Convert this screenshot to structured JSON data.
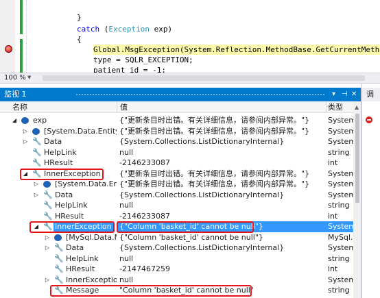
{
  "editor": {
    "lines": [
      {
        "text": "}"
      },
      {
        "kw": "catch",
        "open": " (",
        "ty": "Exception",
        "rest": " exp)"
      },
      {
        "text": "{"
      },
      {
        "text": "Global.MsgException(System.Reflection.MethodBase.GetCurrentMethod().Nam"
      },
      {
        "text": "type = SQLR_EXCEPTION;"
      },
      {
        "text": "patient_id = -1;"
      }
    ]
  },
  "zoom": {
    "level": "100 %"
  },
  "watch": {
    "title": "监视 1",
    "buttons": {
      "dropdown": "▾",
      "pin": "⊣",
      "close": "✕"
    },
    "columns": {
      "name": "名称",
      "value": "值",
      "type": "类型"
    },
    "rows": [
      {
        "name": "exp",
        "value": "{\"更新条目时出错。有关详细信息，请参阅内部异常。\"}",
        "type": "System.E"
      },
      {
        "name": "[System.Data.Entity.In",
        "value": "{\"更新条目时出错。有关详细信息，请参阅内部异常。\"}",
        "type": "System.D"
      },
      {
        "name": "Data",
        "value": "{System.Collections.ListDictionaryInternal}",
        "type": "System.C"
      },
      {
        "name": "HelpLink",
        "value": "null",
        "type": "string"
      },
      {
        "name": "HResult",
        "value": "-2146233087",
        "type": "int"
      },
      {
        "name": "InnerException",
        "value": "{\"更新条目时出错。有关详细信息，请参阅内部异常。\"}",
        "type": "System.E"
      },
      {
        "name": "[System.Data.Entit",
        "value": "{\"更新条目时出错。有关详细信息，请参阅内部异常。\"}",
        "type": "System.D"
      },
      {
        "name": "Data",
        "value": "{System.Collections.ListDictionaryInternal}",
        "type": "System.C"
      },
      {
        "name": "HelpLink",
        "value": "null",
        "type": "string"
      },
      {
        "name": "HResult",
        "value": "-2146233087",
        "type": "int"
      },
      {
        "name": "InnerException",
        "value": "{\"Column 'basket_id' cannot be null\"}",
        "type": "System.E"
      },
      {
        "name": "[MySql.Data.My",
        "value": "{\"Column 'basket_id' cannot be null\"}",
        "type": "MySql.Da"
      },
      {
        "name": "Data",
        "value": "{System.Collections.ListDictionaryInternal}",
        "type": "System.C"
      },
      {
        "name": "HelpLink",
        "value": "null",
        "type": "string"
      },
      {
        "name": "HResult",
        "value": "-2147467259",
        "type": "int"
      },
      {
        "name": "InnerException",
        "value": "null",
        "type": "System.E"
      },
      {
        "name": "Message",
        "value": "\"Column 'basket_id' cannot be null\"",
        "type": "string"
      }
    ]
  },
  "right_pane": {
    "title": "调"
  },
  "colors": {
    "accent": "#007acc",
    "selection": "#3399ff",
    "callout": "#e8141c",
    "highlight": "#fdfbab"
  }
}
